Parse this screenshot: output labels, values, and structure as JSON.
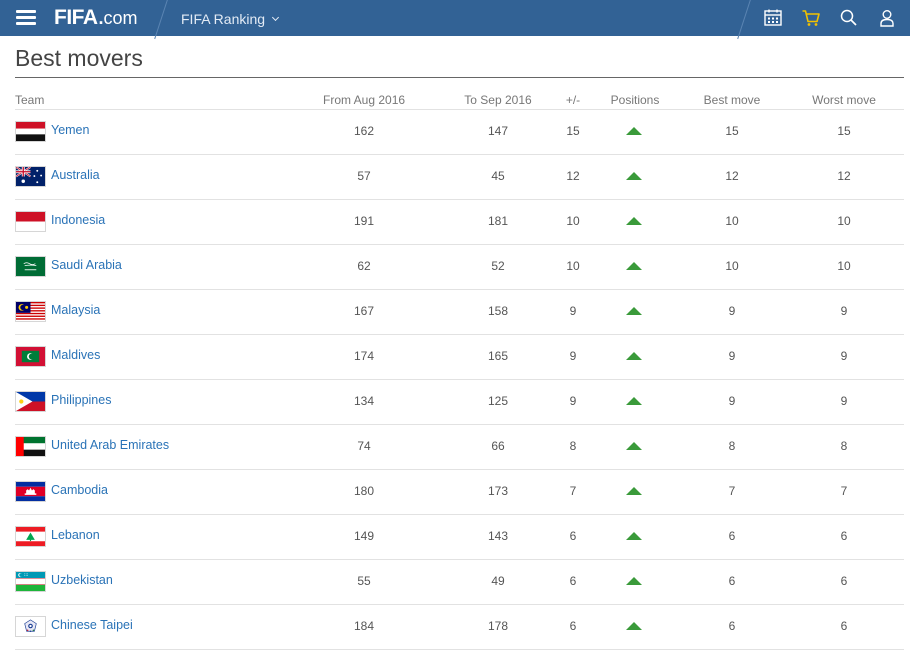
{
  "header": {
    "brand": "FIFA",
    "brand_dot": ".",
    "brand_tld": "com",
    "section": "FIFA Ranking"
  },
  "page": {
    "title": "Best movers"
  },
  "table": {
    "columns": {
      "team": "Team",
      "from": "From Aug 2016",
      "to": "To Sep 2016",
      "change": "+/-",
      "positions": "Positions",
      "best": "Best move",
      "worst": "Worst move"
    },
    "rows": [
      {
        "team": "Yemen",
        "from": "162",
        "to": "147",
        "change": "15",
        "best": "15",
        "worst": "15",
        "positions": "up"
      },
      {
        "team": "Australia",
        "from": "57",
        "to": "45",
        "change": "12",
        "best": "12",
        "worst": "12",
        "positions": "up"
      },
      {
        "team": "Indonesia",
        "from": "191",
        "to": "181",
        "change": "10",
        "best": "10",
        "worst": "10",
        "positions": "up"
      },
      {
        "team": "Saudi Arabia",
        "from": "62",
        "to": "52",
        "change": "10",
        "best": "10",
        "worst": "10",
        "positions": "up"
      },
      {
        "team": "Malaysia",
        "from": "167",
        "to": "158",
        "change": "9",
        "best": "9",
        "worst": "9",
        "positions": "up"
      },
      {
        "team": "Maldives",
        "from": "174",
        "to": "165",
        "change": "9",
        "best": "9",
        "worst": "9",
        "positions": "up"
      },
      {
        "team": "Philippines",
        "from": "134",
        "to": "125",
        "change": "9",
        "best": "9",
        "worst": "9",
        "positions": "up"
      },
      {
        "team": "United Arab Emirates",
        "from": "74",
        "to": "66",
        "change": "8",
        "best": "8",
        "worst": "8",
        "positions": "up"
      },
      {
        "team": "Cambodia",
        "from": "180",
        "to": "173",
        "change": "7",
        "best": "7",
        "worst": "7",
        "positions": "up"
      },
      {
        "team": "Lebanon",
        "from": "149",
        "to": "143",
        "change": "6",
        "best": "6",
        "worst": "6",
        "positions": "up"
      },
      {
        "team": "Uzbekistan",
        "from": "55",
        "to": "49",
        "change": "6",
        "best": "6",
        "worst": "6",
        "positions": "up"
      },
      {
        "team": "Chinese Taipei",
        "from": "184",
        "to": "178",
        "change": "6",
        "best": "6",
        "worst": "6",
        "positions": "up"
      }
    ]
  },
  "icons": {
    "menu": "hamburger-icon",
    "calendar": "calendar-icon",
    "cart": "cart-icon",
    "search": "search-icon",
    "user": "user-icon",
    "position_up": "triangle-up-icon"
  },
  "colors": {
    "topbar": "#326295",
    "link": "#2a73b7",
    "up_arrow": "#3a9a3a",
    "cart_icon": "#f2c200"
  }
}
